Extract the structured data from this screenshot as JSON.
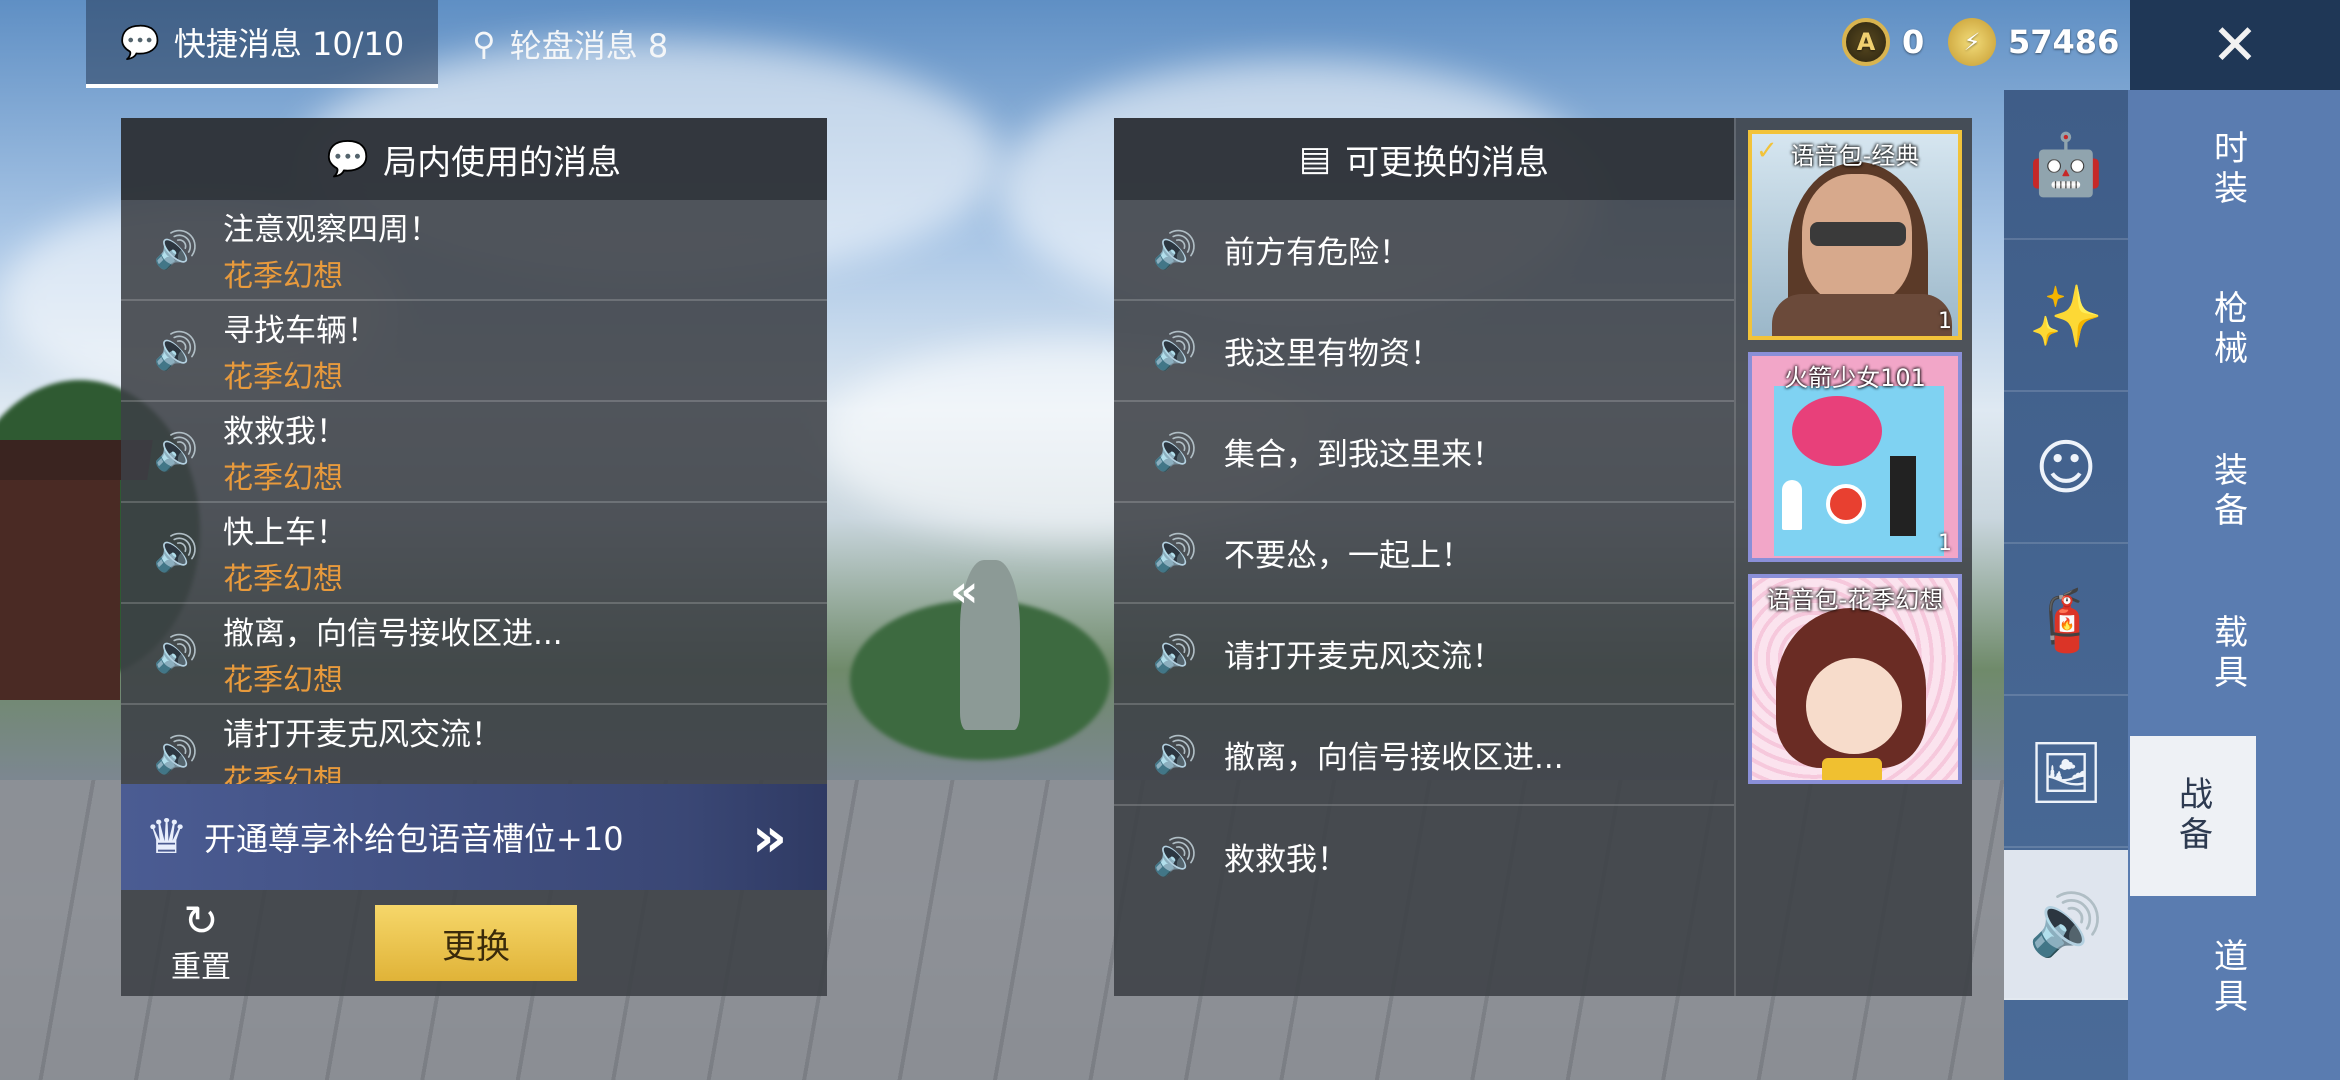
{
  "tabs": [
    {
      "label": "快捷消息 10/10",
      "icon": "chat-bubble-icon",
      "active": true
    },
    {
      "label": "轮盘消息 8",
      "icon": "location-pin-icon",
      "active": false
    }
  ],
  "currency": {
    "ag": "0",
    "bp": "57486"
  },
  "left_panel": {
    "title": "局内使用的消息",
    "items": [
      {
        "title": "注意观察四周！",
        "sub": "花季幻想"
      },
      {
        "title": "寻找车辆！",
        "sub": "花季幻想"
      },
      {
        "title": "救救我！",
        "sub": "花季幻想"
      },
      {
        "title": "快上车！",
        "sub": "花季幻想"
      },
      {
        "title": "撤离，向信号接收区进...",
        "sub": "花季幻想"
      },
      {
        "title": "请打开麦克风交流！",
        "sub": "花季幻想"
      }
    ],
    "promo": "开通尊享补给包语音槽位+10",
    "reset_label": "重置",
    "change_label": "更换"
  },
  "right_panel": {
    "title": "可更换的消息",
    "items": [
      "前方有危险！",
      "我这里有物资！",
      "集合，到我这里来！",
      "不要怂，一起上！",
      "请打开麦克风交流！",
      "撤离，向信号接收区进...",
      "救救我！"
    ]
  },
  "voice_packs": [
    {
      "label": "语音包-经典",
      "count": "1",
      "selected": true
    },
    {
      "label": "火箭少女101",
      "count": "1",
      "selected": false
    },
    {
      "label": "语音包-花季幻想",
      "count": "",
      "selected": false
    }
  ],
  "nav": [
    "时装",
    "枪械",
    "装备",
    "载具",
    "战备",
    "道具"
  ],
  "active_nav": "战备",
  "colors": {
    "accent_orange": "#e89a3c",
    "button_gold": "#e0b338",
    "nav_blue": "#5a7cb0"
  }
}
